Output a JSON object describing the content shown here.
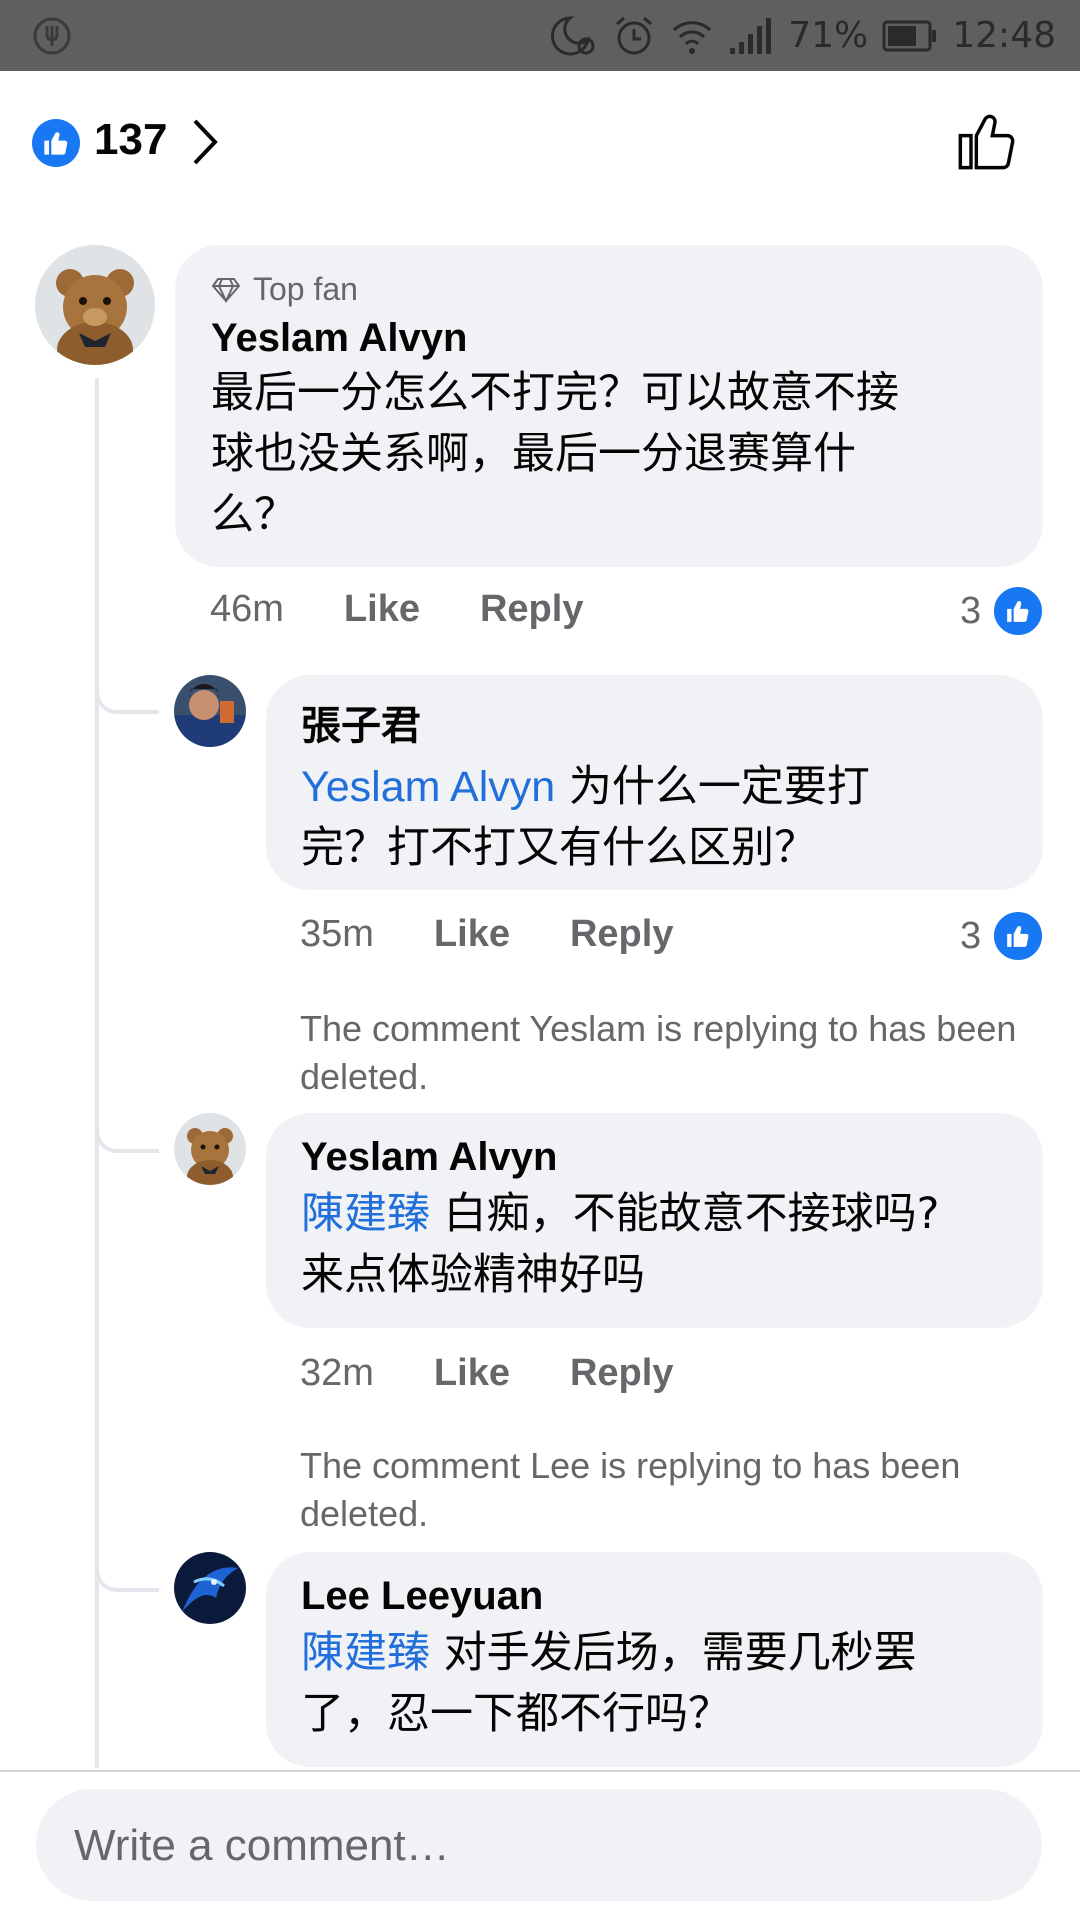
{
  "status_bar": {
    "battery_percent": "71%",
    "time": "12:48",
    "icons": [
      "fork-icon",
      "moon-icon",
      "alarm-icon",
      "wifi-icon",
      "signal-icon",
      "battery-icon"
    ]
  },
  "header": {
    "like_count": "137",
    "icons": [
      "like-badge-icon",
      "chevron-right-icon",
      "thumbs-up-outline-icon"
    ]
  },
  "comments": [
    {
      "badge": "Top fan",
      "author": "Yeslam Alvyn",
      "text": "最后一分怎么不打完？可以故意不接球也没关系啊，最后一分退赛算什么？",
      "line1": "最后一分怎么不打完？可以故意不接",
      "line2": "球也没关系啊，最后一分退赛算什",
      "line3": "么？",
      "time": "46m",
      "like_label": "Like",
      "reply_label": "Reply",
      "reactions": "3"
    },
    {
      "author": "張子君",
      "mention": "Yeslam Alvyn",
      "line1": " 为什么一定要打",
      "line2": "完？打不打又有什么区别？",
      "time": "35m",
      "like_label": "Like",
      "reply_label": "Reply",
      "reactions": "3"
    },
    {
      "deleted_notice": "The comment Yeslam is replying to has been deleted.",
      "author": "Yeslam Alvyn",
      "mention": "陳建臻",
      "line1": " 白痴，不能故意不接球吗?",
      "line2": "来点体验精神好吗",
      "time": "32m",
      "like_label": "Like",
      "reply_label": "Reply"
    },
    {
      "deleted_notice": "The comment Lee is replying to has been deleted.",
      "author": "Lee Leeyuan",
      "mention": "陳建臻",
      "line1": " 对手发后场，需要几秒罢",
      "line2": "了，忍一下都不行吗？"
    }
  ],
  "composer": {
    "placeholder": "Write a comment…"
  },
  "colors": {
    "facebook_blue": "#1877f2",
    "mention_blue": "#216fdb",
    "bubble_gray": "#f0f2f5",
    "meta_gray": "#65676b",
    "status_bar": "#5f5f5f"
  }
}
